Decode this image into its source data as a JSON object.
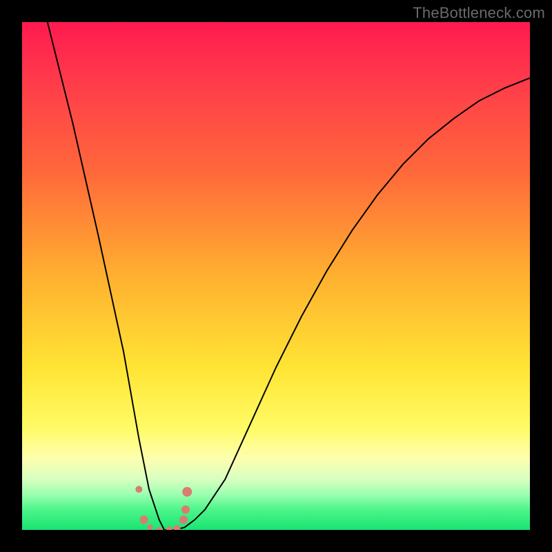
{
  "watermark": "TheBottleneck.com",
  "chart_data": {
    "type": "line",
    "title": "",
    "xlabel": "",
    "ylabel": "",
    "xlim": [
      0,
      100
    ],
    "ylim": [
      0,
      100
    ],
    "series": [
      {
        "name": "curve",
        "x": [
          5,
          10,
          15,
          20,
          23,
          25,
          27,
          28,
          29,
          30,
          32,
          34,
          36,
          40,
          45,
          50,
          55,
          60,
          65,
          70,
          75,
          80,
          85,
          90,
          95,
          100
        ],
        "values": [
          100,
          80,
          58,
          35,
          18,
          8,
          2,
          0,
          0,
          0,
          0.5,
          2,
          4,
          10,
          21,
          32,
          42,
          51,
          59,
          66,
          72,
          77,
          81,
          84.5,
          87,
          89
        ]
      }
    ],
    "markers": [
      {
        "x": 23.0,
        "y": 8.0,
        "r": 5
      },
      {
        "x": 24.0,
        "y": 2.0,
        "r": 6
      },
      {
        "x": 25.2,
        "y": 0.5,
        "r": 4
      },
      {
        "x": 27.0,
        "y": 0.0,
        "r": 4
      },
      {
        "x": 29.0,
        "y": 0.0,
        "r": 5
      },
      {
        "x": 30.5,
        "y": 0.3,
        "r": 5
      },
      {
        "x": 31.8,
        "y": 2.0,
        "r": 6
      },
      {
        "x": 32.2,
        "y": 4.0,
        "r": 6
      },
      {
        "x": 32.5,
        "y": 7.5,
        "r": 7
      }
    ],
    "colors": {
      "marker": "#d97c72",
      "line": "#000000"
    }
  }
}
